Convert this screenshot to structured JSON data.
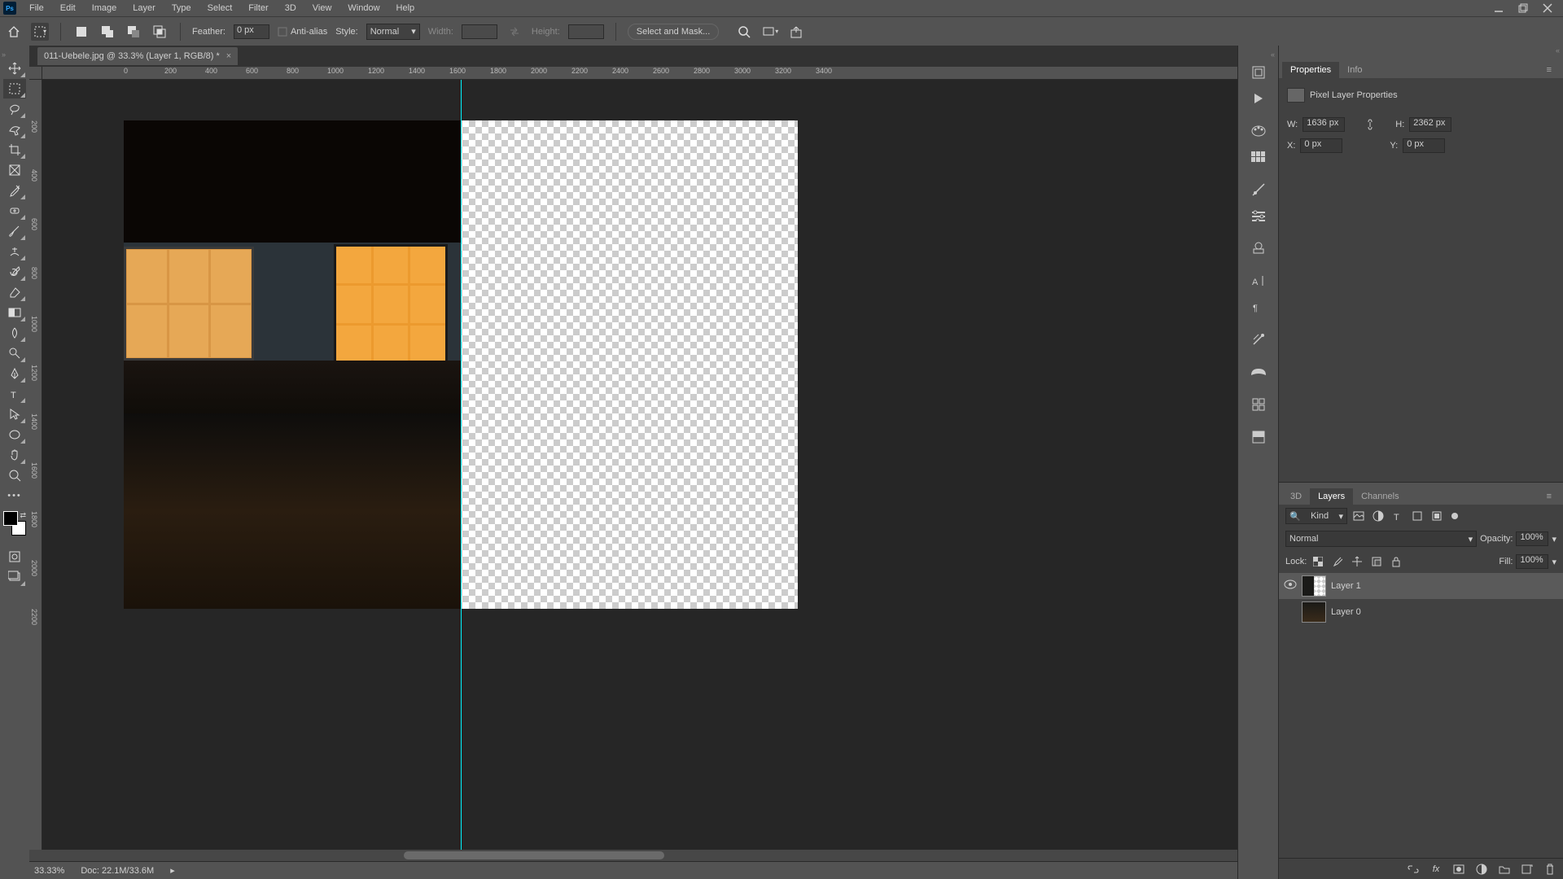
{
  "menubar": {
    "items": [
      "File",
      "Edit",
      "Image",
      "Layer",
      "Type",
      "Select",
      "Filter",
      "3D",
      "View",
      "Window",
      "Help"
    ]
  },
  "document": {
    "tab_title": "011-Uebele.jpg @ 33.3% (Layer 1, RGB/8) *",
    "zoom": "33.33%",
    "docsize": "Doc: 22.1M/33.6M"
  },
  "options": {
    "feather_label": "Feather:",
    "feather_value": "0 px",
    "antialias_label": "Anti-alias",
    "style_label": "Style:",
    "style_value": "Normal",
    "width_label": "Width:",
    "height_label": "Height:",
    "select_mask": "Select and Mask..."
  },
  "ruler_h": [
    "0",
    "200",
    "400",
    "600",
    "800",
    "1000",
    "1200",
    "1400",
    "1600",
    "1800",
    "2000",
    "2200",
    "2400",
    "2600",
    "2800",
    "3000",
    "3200",
    "3400"
  ],
  "ruler_v": [
    "200",
    "400",
    "600",
    "800",
    "1000",
    "1200",
    "1400",
    "1600",
    "1800",
    "2000",
    "2200"
  ],
  "properties": {
    "tab_properties": "Properties",
    "tab_info": "Info",
    "title": "Pixel Layer Properties",
    "w_label": "W:",
    "w_value": "1636 px",
    "h_label": "H:",
    "h_value": "2362 px",
    "x_label": "X:",
    "x_value": "0 px",
    "y_label": "Y:",
    "y_value": "0 px"
  },
  "layerspanel": {
    "tab_3d": "3D",
    "tab_layers": "Layers",
    "tab_channels": "Channels",
    "kind": "Kind",
    "blend": "Normal",
    "opacity_label": "Opacity:",
    "opacity": "100%",
    "lock_label": "Lock:",
    "fill_label": "Fill:",
    "fill": "100%",
    "layers": [
      {
        "name": "Layer 1",
        "visible": true,
        "selected": true,
        "thumb": "half"
      },
      {
        "name": "Layer 0",
        "visible": false,
        "selected": false,
        "thumb": "full"
      }
    ]
  }
}
